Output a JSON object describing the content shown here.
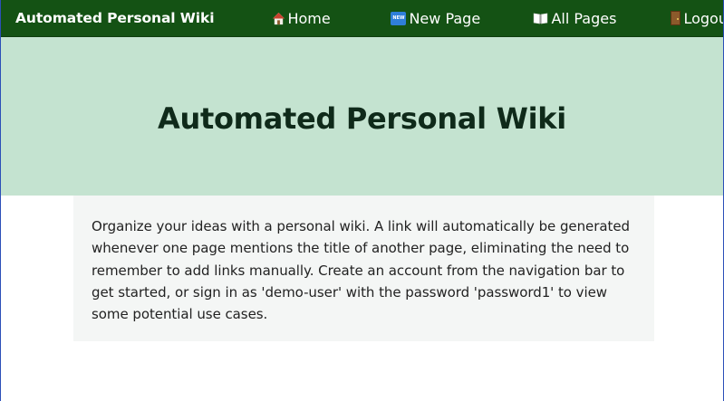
{
  "navbar": {
    "brand": "Automated Personal Wiki",
    "items": [
      {
        "label": "Home",
        "icon": "house-icon"
      },
      {
        "label": "New Page",
        "icon": "new-badge-icon"
      },
      {
        "label": "All Pages",
        "icon": "open-book-icon"
      },
      {
        "label": "Logout",
        "icon": "door-icon"
      }
    ]
  },
  "hero": {
    "title": "Automated Personal Wiki"
  },
  "intro": {
    "text": "Organize your ideas with a personal wiki. A link will automatically be generated whenever one page mentions the title of another page, eliminating the need to remember to add links manually. Create an account from the navigation bar to get started, or sign in as 'demo-user' with the password 'password1' to view some potential use cases."
  },
  "colors": {
    "navbar_bg": "#145214",
    "hero_bg": "#c4e3d0",
    "intro_bg": "#f4f6f5"
  }
}
